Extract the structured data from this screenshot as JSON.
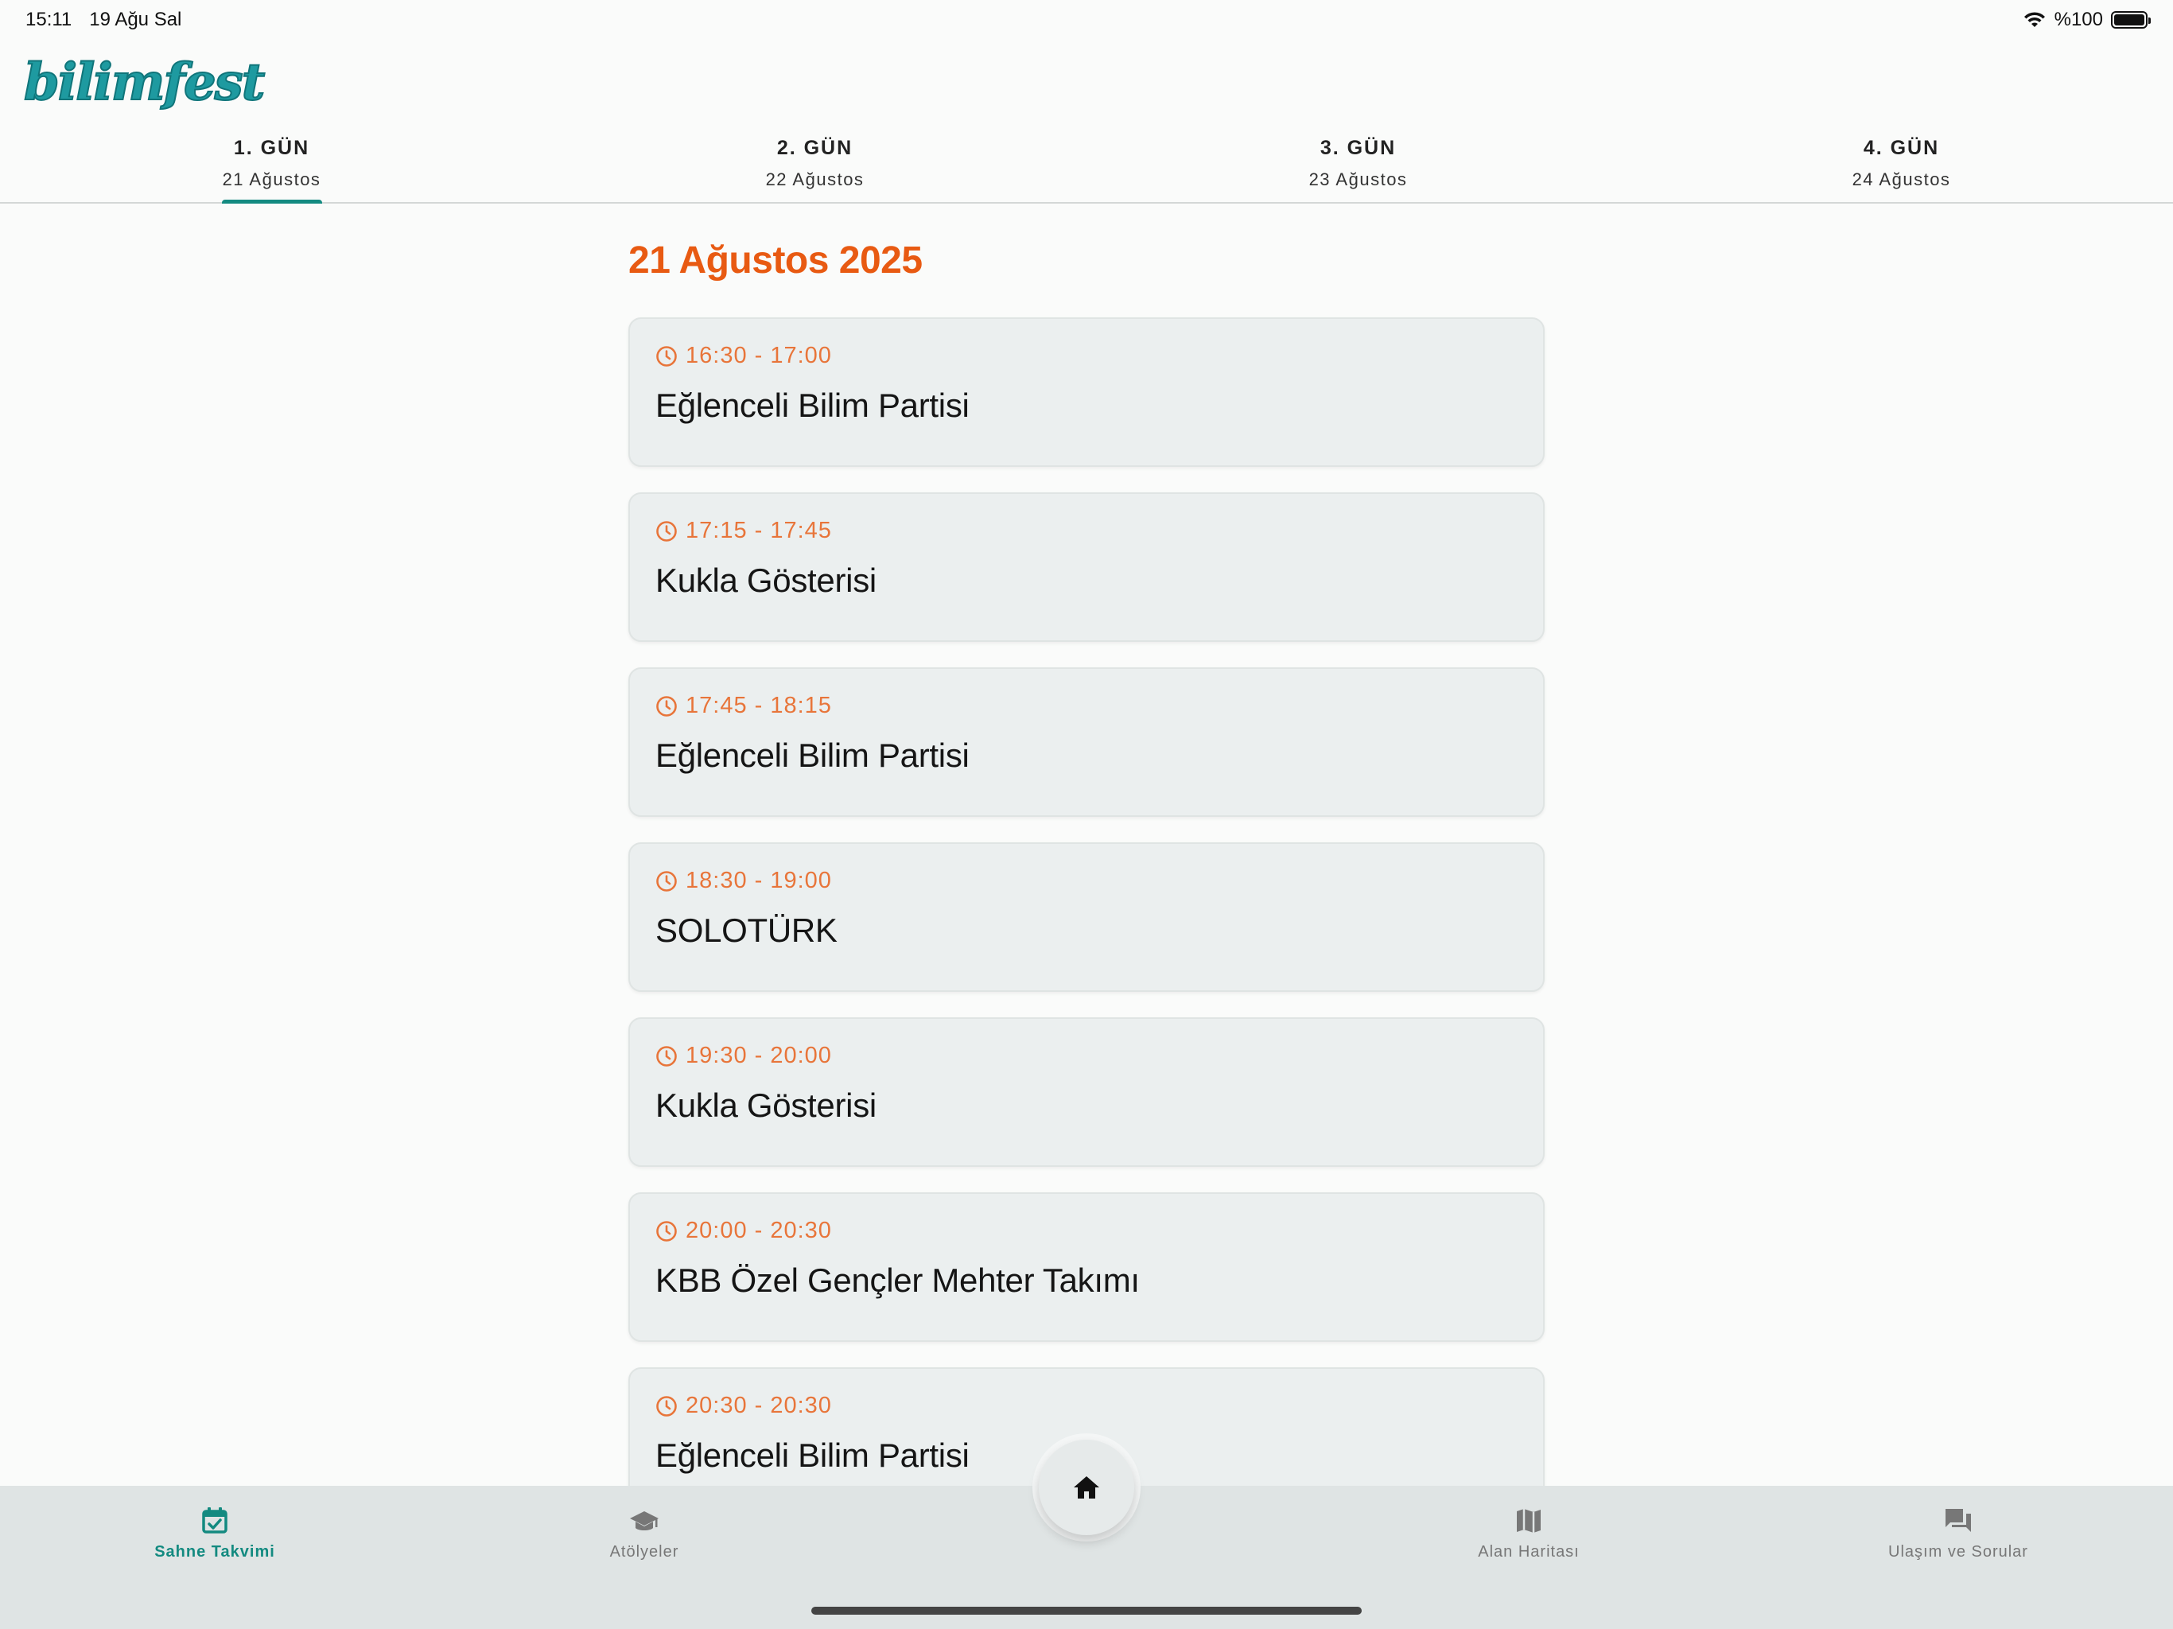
{
  "status_bar": {
    "time": "15:11",
    "date": "19 Ağu Sal",
    "battery": "%100"
  },
  "logo": {
    "text": "bilimfest"
  },
  "day_tabs": [
    {
      "title": "1. GÜN",
      "date": "21 Ağustos",
      "active": true
    },
    {
      "title": "2. GÜN",
      "date": "22 Ağustos",
      "active": false
    },
    {
      "title": "3. GÜN",
      "date": "23 Ağustos",
      "active": false
    },
    {
      "title": "4. GÜN",
      "date": "24 Ağustos",
      "active": false
    }
  ],
  "main": {
    "date_heading": "21 Ağustos 2025",
    "events": [
      {
        "time": "16:30 - 17:00",
        "title": "Eğlenceli Bilim Partisi"
      },
      {
        "time": "17:15 - 17:45",
        "title": "Kukla Gösterisi"
      },
      {
        "time": "17:45 - 18:15",
        "title": "Eğlenceli Bilim Partisi"
      },
      {
        "time": "18:30 - 19:00",
        "title": "SOLOTÜRK"
      },
      {
        "time": "19:30 - 20:00",
        "title": "Kukla Gösterisi"
      },
      {
        "time": "20:00 - 20:30",
        "title": "KBB Özel Gençler Mehter Takımı"
      },
      {
        "time": "20:30 - 20:30",
        "title": "Eğlenceli Bilim Partisi"
      }
    ]
  },
  "bottom_nav": {
    "items": [
      {
        "label": "Sahne Takvimi",
        "icon": "calendar-check-icon",
        "active": true
      },
      {
        "label": "Atölyeler",
        "icon": "graduation-cap-icon",
        "active": false
      },
      {
        "label": "Alan Haritası",
        "icon": "map-icon",
        "active": false
      },
      {
        "label": "Ulaşım ve Sorular",
        "icon": "chat-icon",
        "active": false
      }
    ],
    "home_icon": "home-icon"
  },
  "colors": {
    "accent": "#138a80",
    "heading_orange": "#e85a12",
    "time_orange": "#e8753a",
    "card_bg": "#ebefef",
    "nav_bg": "#dfe4e4"
  }
}
